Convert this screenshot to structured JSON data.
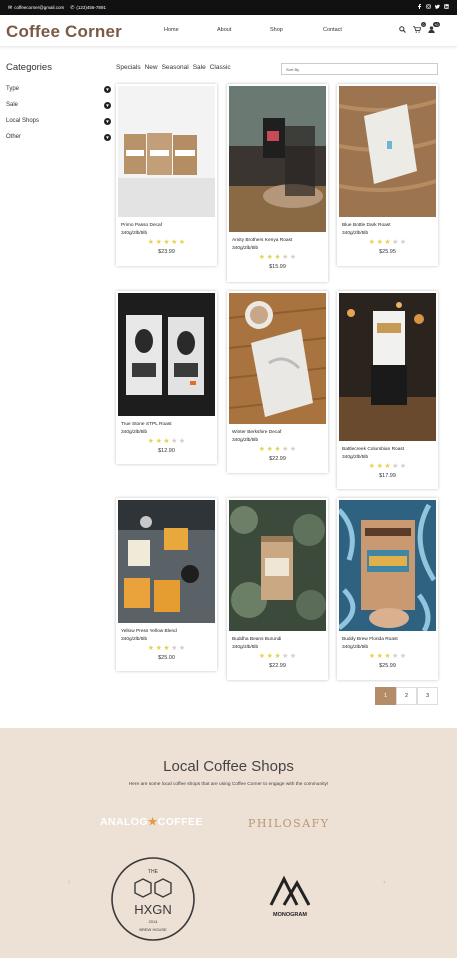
{
  "topbar": {
    "email": "coffeecorner@gmail.com",
    "phone": "(123)456-7891",
    "social": [
      "facebook-icon",
      "instagram-icon",
      "twitter-icon",
      "linkedin-icon"
    ]
  },
  "header": {
    "brand": "Coffee Corner",
    "nav": [
      "Home",
      "About",
      "Shop",
      "Contact"
    ],
    "cart_count": "0",
    "account_count": "+0"
  },
  "sidebar": {
    "title": "Categories",
    "items": [
      "Type",
      "Sale",
      "Local Shops",
      "Other"
    ]
  },
  "filters": {
    "tabs": [
      "Specials",
      "New",
      "Seasonal",
      "Sale",
      "Classic"
    ],
    "sort_placeholder": "Sort By"
  },
  "products": [
    {
      "name": "Primo Passo Decaf",
      "weight": "340g/2lb/5lb",
      "rating": 5,
      "price": "$23.99"
    },
    {
      "name": "Amity Brothers Kenya Roast",
      "weight": "340g/2lb/5lb",
      "rating": 3,
      "price": "$15.99"
    },
    {
      "name": "Blue Bottle Dark Roast",
      "weight": "340g/2lb/5lb",
      "rating": 3,
      "price": "$25.95"
    },
    {
      "name": "True Stone STPL Roast",
      "weight": "340g/2lb/5lb",
      "rating": 3,
      "price": "$12.90"
    },
    {
      "name": "Winter Berkshire Decaf",
      "weight": "340g/2lb/5lb",
      "rating": 3,
      "price": "$22.99"
    },
    {
      "name": "Battlecreek Columbian Roast",
      "weight": "340g/2lb/5lb",
      "rating": 3,
      "price": "$17.99"
    },
    {
      "name": "Yellow Press Yellow Blend",
      "weight": "340g/2lb/5lb",
      "rating": 3,
      "price": "$25.00"
    },
    {
      "name": "Buddha Beans Burundi",
      "weight": "340g/2lb/5lb",
      "rating": 3,
      "price": "$22.99"
    },
    {
      "name": "Buddy Brew Florida Roast",
      "weight": "340g/2lb/5lb",
      "rating": 3,
      "price": "$25.99"
    }
  ],
  "pagination": [
    "1",
    "2",
    "3"
  ],
  "local_shops": {
    "title": "Local Coffee Shops",
    "description": "Here are some local coffee shops that are using Coffee Corner to engage with the community!",
    "logos": {
      "analog": [
        "ANALOG",
        "COFFEE"
      ],
      "philosafy": "PHILOSAFY",
      "hxgn": [
        "THE",
        "HXGN",
        "2014",
        "BREW HOUSE"
      ],
      "monogram": "MONOGRAM"
    }
  },
  "colors": {
    "brand": "#7a5a44",
    "accent": "#b58c68",
    "footer_bg": "#ede0d5",
    "star_on": "#e8d24a"
  }
}
